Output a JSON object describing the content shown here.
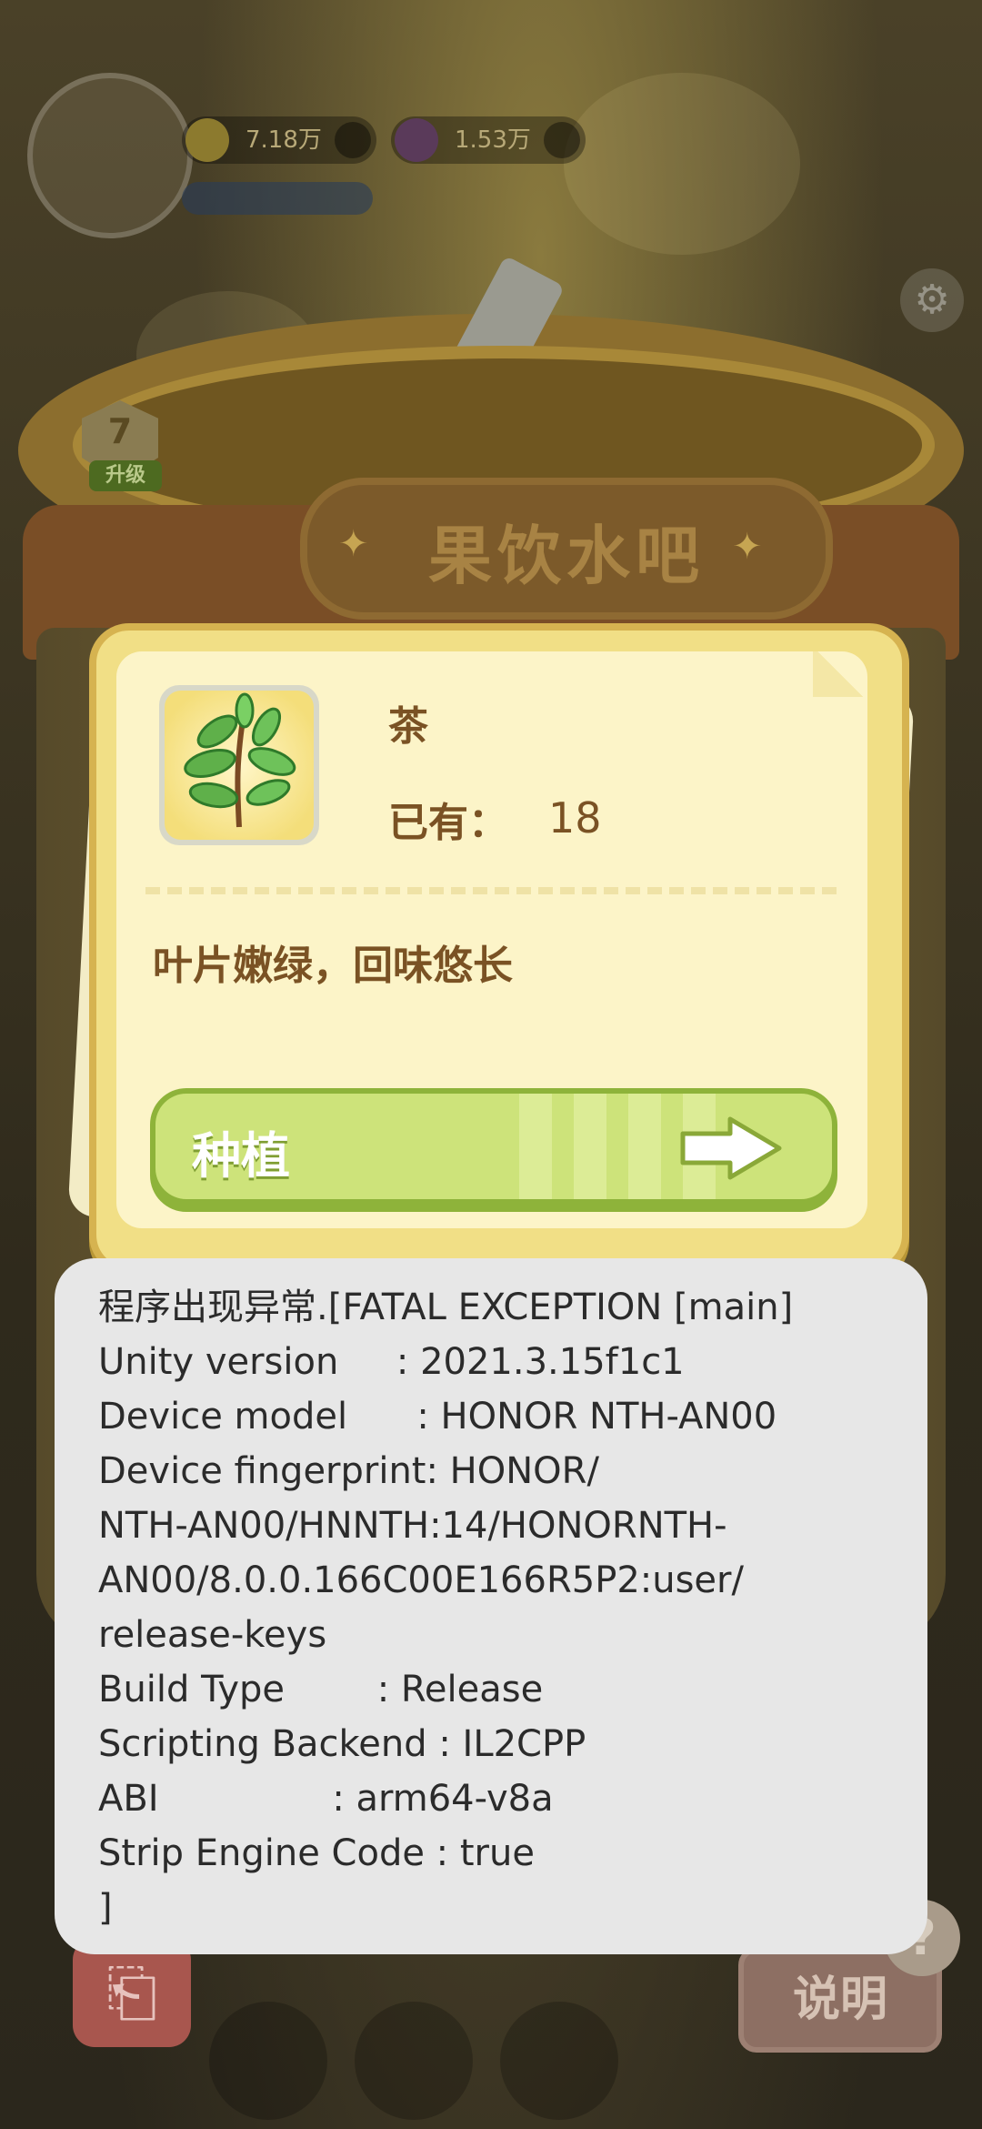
{
  "hud": {
    "coins": "7.18万",
    "gems": "1.53万"
  },
  "jar": {
    "sign": "果饮水吧",
    "level": "7",
    "level_tag": "升级"
  },
  "item_card": {
    "name": "茶",
    "owned_label": "已有：",
    "owned_count": "18",
    "description": "叶片嫩绿，回味悠长",
    "plant_button": "种植"
  },
  "crash": {
    "lines": [
      "程序出现异常.[FATAL EXCEPTION [main]",
      "Unity version     : 2021.3.15f1c1",
      "Device model      : HONOR NTH-AN00",
      "Device fingerprint: HONOR/",
      "NTH-AN00/HNNTH:14/HONORNTH-",
      "AN00/8.0.0.166C00E166R5P2:user/",
      "release-keys",
      "Build Type        : Release",
      "Scripting Backend : IL2CPP",
      "ABI               : arm64-v8a",
      "Strip Engine Code : true",
      "]"
    ]
  },
  "bottom": {
    "help_button": "说明",
    "help_badge": "?"
  },
  "colors": {
    "card_bg": "#fcf4c8",
    "button_green": "#cde37a",
    "text_brown": "#7a5224",
    "dialog_bg": "#e7e7e7"
  }
}
